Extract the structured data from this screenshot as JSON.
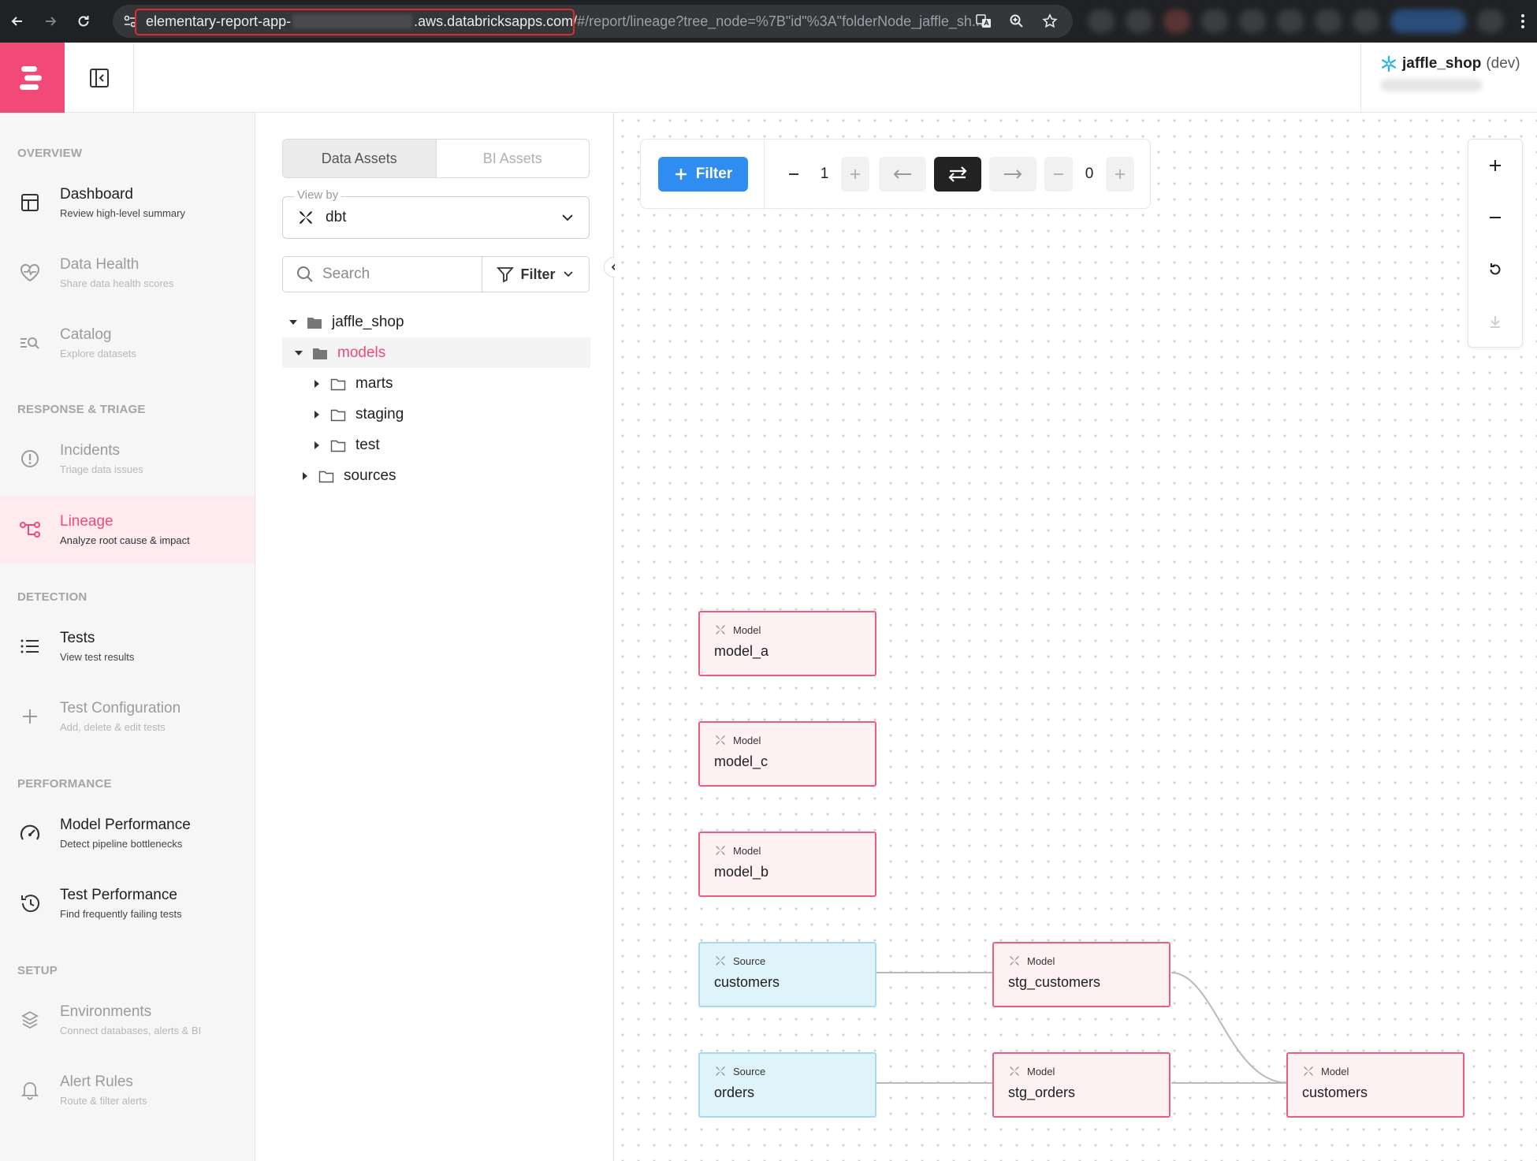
{
  "browser": {
    "url_host_start": "elementary-report-app-",
    "url_host_end": ".aws.databricksapps.com/",
    "url_path": "#/report/lineage?tree_node=%7B\"id\"%3A\"folderNode_jaffle_sh..."
  },
  "header": {
    "env_name": "jaffle_shop",
    "env_tag": "(dev)"
  },
  "sidebar": {
    "sections": [
      {
        "label": "OVERVIEW"
      },
      {
        "label": "RESPONSE & TRIAGE"
      },
      {
        "label": "DETECTION"
      },
      {
        "label": "PERFORMANCE"
      },
      {
        "label": "SETUP"
      }
    ],
    "items": [
      {
        "title": "Dashboard",
        "subtitle": "Review high-level summary",
        "icon": "layout-icon"
      },
      {
        "title": "Data Health",
        "subtitle": "Share data health scores",
        "icon": "heart-pulse-icon"
      },
      {
        "title": "Catalog",
        "subtitle": "Explore datasets",
        "icon": "catalog-search-icon"
      },
      {
        "title": "Incidents",
        "subtitle": "Triage data issues",
        "icon": "alert-circle-icon"
      },
      {
        "title": "Lineage",
        "subtitle": "Analyze root cause & impact",
        "icon": "lineage-icon"
      },
      {
        "title": "Tests",
        "subtitle": "View test results",
        "icon": "list-icon"
      },
      {
        "title": "Test Configuration",
        "subtitle": "Add, delete & edit tests",
        "icon": "plus-icon"
      },
      {
        "title": "Model Performance",
        "subtitle": "Detect pipeline bottlenecks",
        "icon": "gauge-icon"
      },
      {
        "title": "Test Performance",
        "subtitle": "Find frequently failing tests",
        "icon": "history-icon"
      },
      {
        "title": "Environments",
        "subtitle": "Connect databases, alerts & BI",
        "icon": "layers-icon"
      },
      {
        "title": "Alert Rules",
        "subtitle": "Route & filter alerts",
        "icon": "bell-icon"
      }
    ],
    "active": "Lineage"
  },
  "tree_panel": {
    "tabs": [
      {
        "label": "Data Assets"
      },
      {
        "label": "BI Assets"
      }
    ],
    "view_by_label": "View by",
    "view_by_value": "dbt",
    "search_placeholder": "Search",
    "filter_label": "Filter",
    "nodes": [
      {
        "label": "jaffle_shop",
        "expanded": true,
        "level": 0
      },
      {
        "label": "models",
        "expanded": true,
        "level": 1,
        "selected": true
      },
      {
        "label": "marts",
        "expanded": false,
        "level": 2
      },
      {
        "label": "staging",
        "expanded": false,
        "level": 2
      },
      {
        "label": "test",
        "expanded": false,
        "level": 2
      },
      {
        "label": "sources",
        "expanded": false,
        "level": 1
      }
    ]
  },
  "toolbar": {
    "filter_label": "Filter",
    "upstream_depth": "1",
    "downstream_depth": "0",
    "direction": "both"
  },
  "graph": {
    "nodes": [
      {
        "id": "model_a",
        "type": "Model",
        "name": "model_a"
      },
      {
        "id": "model_c",
        "type": "Model",
        "name": "model_c"
      },
      {
        "id": "model_b",
        "type": "Model",
        "name": "model_b"
      },
      {
        "id": "src_customers",
        "type": "Source",
        "name": "customers"
      },
      {
        "id": "stg_customers",
        "type": "Model",
        "name": "stg_customers"
      },
      {
        "id": "src_orders",
        "type": "Source",
        "name": "orders"
      },
      {
        "id": "stg_orders",
        "type": "Model",
        "name": "stg_orders"
      },
      {
        "id": "customers",
        "type": "Model",
        "name": "customers"
      }
    ],
    "edges": [
      [
        "src_customers",
        "stg_customers"
      ],
      [
        "src_orders",
        "stg_orders"
      ],
      [
        "stg_customers",
        "customers"
      ],
      [
        "stg_orders",
        "customers"
      ]
    ]
  },
  "colors": {
    "brand": "#f24a77",
    "filter_button": "#2f8cf0",
    "model_border": "#f05b80",
    "model_fill": "#fdf1f3",
    "source_border": "#a7daf0",
    "source_fill": "#dff3fb"
  }
}
